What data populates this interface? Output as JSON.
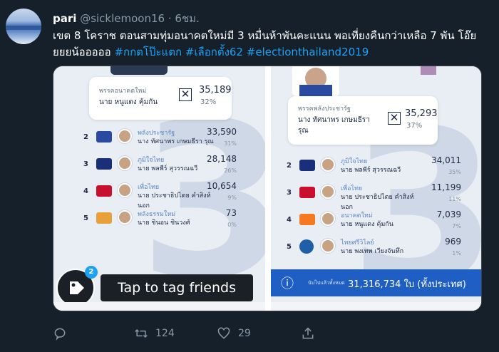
{
  "tweet": {
    "display_name": "pari",
    "handle": "@sicklemoon16",
    "separator": "·",
    "time": "6ชม.",
    "text_plain": "เขต 8 โคราช ตอนสามทุ่มอนาคตใหม่มี 3 หมื่นห้าพันคะแนน พอเที่ยงคืนกว่าเหลือ 7 พัน โอ๊ยยยยน้อออออ",
    "hashtags": [
      "#กกตโป๊ะแตก",
      "#เลือกตั้ง62",
      "#electionthailand2019"
    ]
  },
  "image": {
    "left": {
      "top_card": {
        "party": "พรรคอนาคตใหม่",
        "name": "นาย หนูแดง คุ้มกัน",
        "mark": "✕",
        "votes": "35,189",
        "pct": "32%"
      },
      "rows": [
        {
          "rank": "2",
          "party": "พลังประชารัฐ",
          "name": "นาง ทัศนาพร เกษมธีรา รุณ",
          "votes": "33,590",
          "pct": "31%",
          "logo_color": "#2a4aa0"
        },
        {
          "rank": "3",
          "party": "ภูมิใจไทย",
          "name": "นาย พลพีร์ สุวรรณฉวี",
          "votes": "28,148",
          "pct": "26%",
          "logo_color": "#1a2f7a"
        },
        {
          "rank": "4",
          "party": "เพื่อไทย",
          "name": "นาย ประชาธิปไตย คำสิงห์ นอก",
          "votes": "10,654",
          "pct": "9%",
          "logo_color": "#c8102e"
        },
        {
          "rank": "5",
          "party": "พลังธรรมใหม่",
          "name": "นาย ชินอน ชินวงศ์",
          "votes": "73",
          "pct": "0%",
          "logo_color": "#e8a13a"
        }
      ]
    },
    "right": {
      "top_card": {
        "party": "พรรคพลังประชารัฐ",
        "name": "นาง ทัศนาพร เกษมธีรา รุณ",
        "mark": "✕",
        "votes": "35,293",
        "pct": "37%"
      },
      "rows": [
        {
          "rank": "2",
          "party": "ภูมิใจไทย",
          "name": "นาย พลพีร์ สุวรรณฉวี",
          "votes": "34,011",
          "pct": "35%",
          "logo_color": "#1a2f7a"
        },
        {
          "rank": "3",
          "party": "เพื่อไทย",
          "name": "นาย ประชาธิปไตย คำสิงห์ นอก",
          "votes": "11,199",
          "pct": "11%",
          "logo_color": "#c8102e"
        },
        {
          "rank": "4",
          "party": "อนาคตใหม่",
          "name": "นาย หนูแดง คุ้มกัน",
          "votes": "7,039",
          "pct": "7%",
          "logo_color": "#f47920"
        },
        {
          "rank": "5",
          "party": "ไทยศรีวิไลย์",
          "name": "นาย พงเทพ เวียงจันทึก",
          "votes": "969",
          "pct": "1%",
          "logo_color": "#1f5fa8"
        }
      ],
      "footer_label": "นับไปแล้วทั้งหมด",
      "footer_total": "31,316,734 ใบ (ทั้งประเทศ)",
      "footer_icon": "ⓘ"
    },
    "tag_prompt": "Tap to tag friends",
    "tag_count": "2"
  },
  "actions": {
    "reply_count": "",
    "retweet_count": "124",
    "like_count": "29"
  },
  "colors": {
    "background": "#15202b",
    "muted": "#8899a6",
    "link": "#1da1f2",
    "footer_bar": "#1f5fc4"
  }
}
